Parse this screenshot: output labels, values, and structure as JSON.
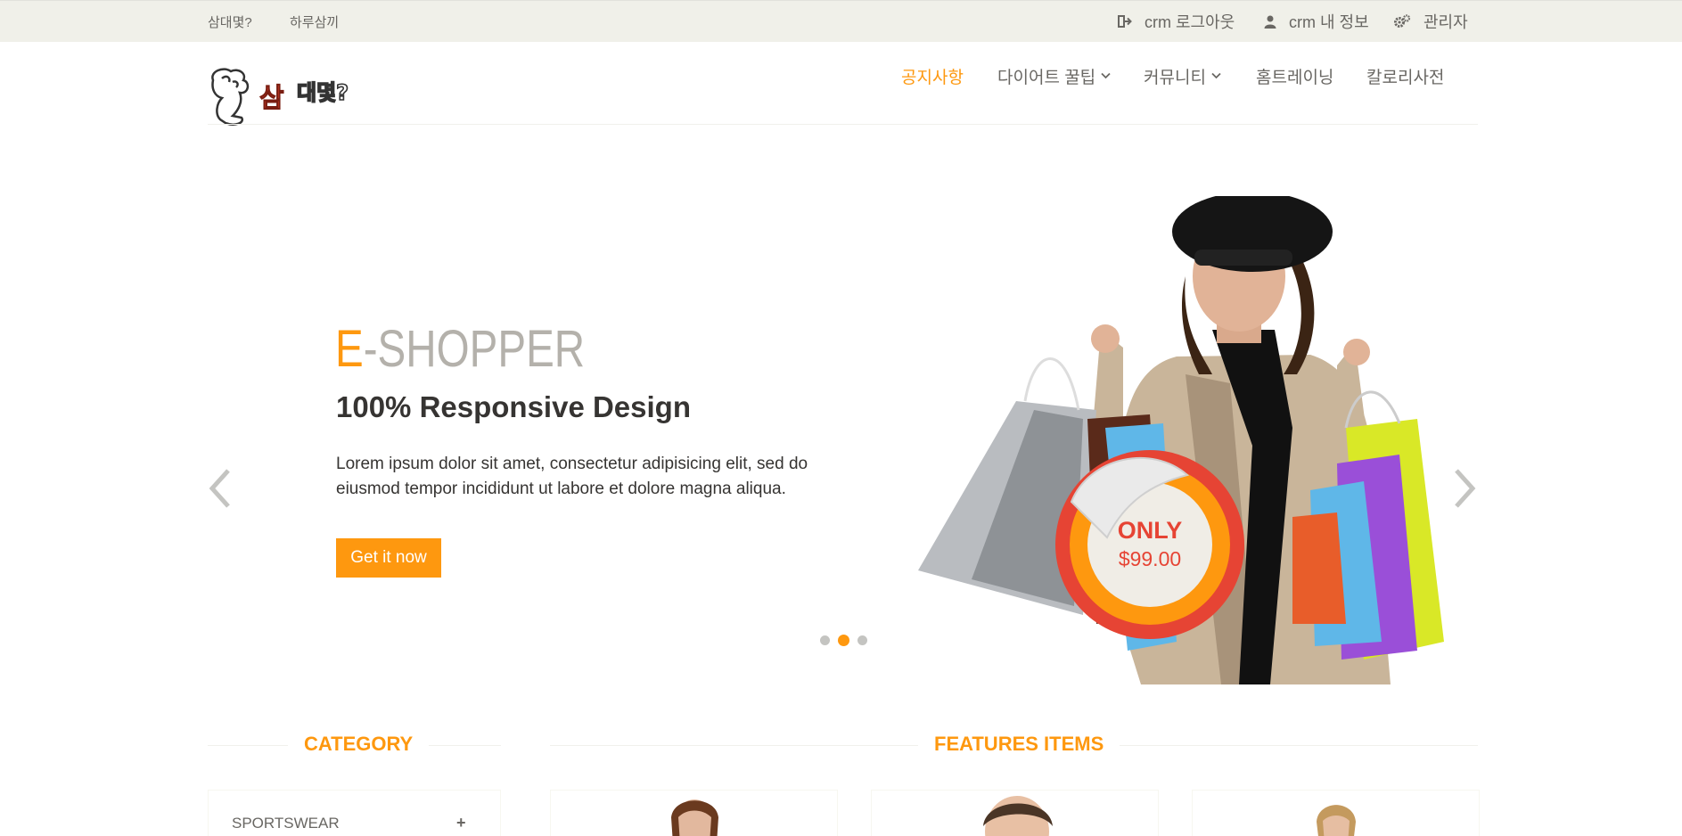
{
  "topbar": {
    "left_links": [
      "삼대몇?",
      "하루삼끼"
    ],
    "logout": {
      "icon": "sign-out-icon",
      "label": "crm 로그아웃"
    },
    "profile": {
      "icon": "user-icon",
      "label": "crm 내 정보"
    },
    "admin": {
      "icon": "gears-icon",
      "label": "관리자"
    }
  },
  "header": {
    "logo_text": "삼대몇?",
    "nav": [
      {
        "label": "공지사항",
        "active": true
      },
      {
        "label": "다이어트 꿀팁",
        "dropdown": true
      },
      {
        "label": "커뮤니티",
        "dropdown": true
      },
      {
        "label": "홈트레이닝"
      },
      {
        "label": "칼로리사전"
      }
    ]
  },
  "slider": {
    "brand_accent": "E",
    "brand_rest": "-SHOPPER",
    "subtitle": "100% Responsive Design",
    "text": "Lorem ipsum dolor sit amet, consectetur adipisicing elit, sed do eiusmod tempor incididunt ut labore et dolore magna aliqua.",
    "button": "Get it now",
    "price_only": "ONLY",
    "price_value": "$99.00",
    "active_slide": 2,
    "slide_count": 3
  },
  "sections": {
    "category_title": "CATEGORY",
    "features_title": "FEATURES ITEMS",
    "category_first": "SPORTSWEAR",
    "category_toggle": "+"
  },
  "colors": {
    "accent": "#fe980f",
    "topbar_bg": "#f0f0e9",
    "price_red": "#e64434"
  }
}
